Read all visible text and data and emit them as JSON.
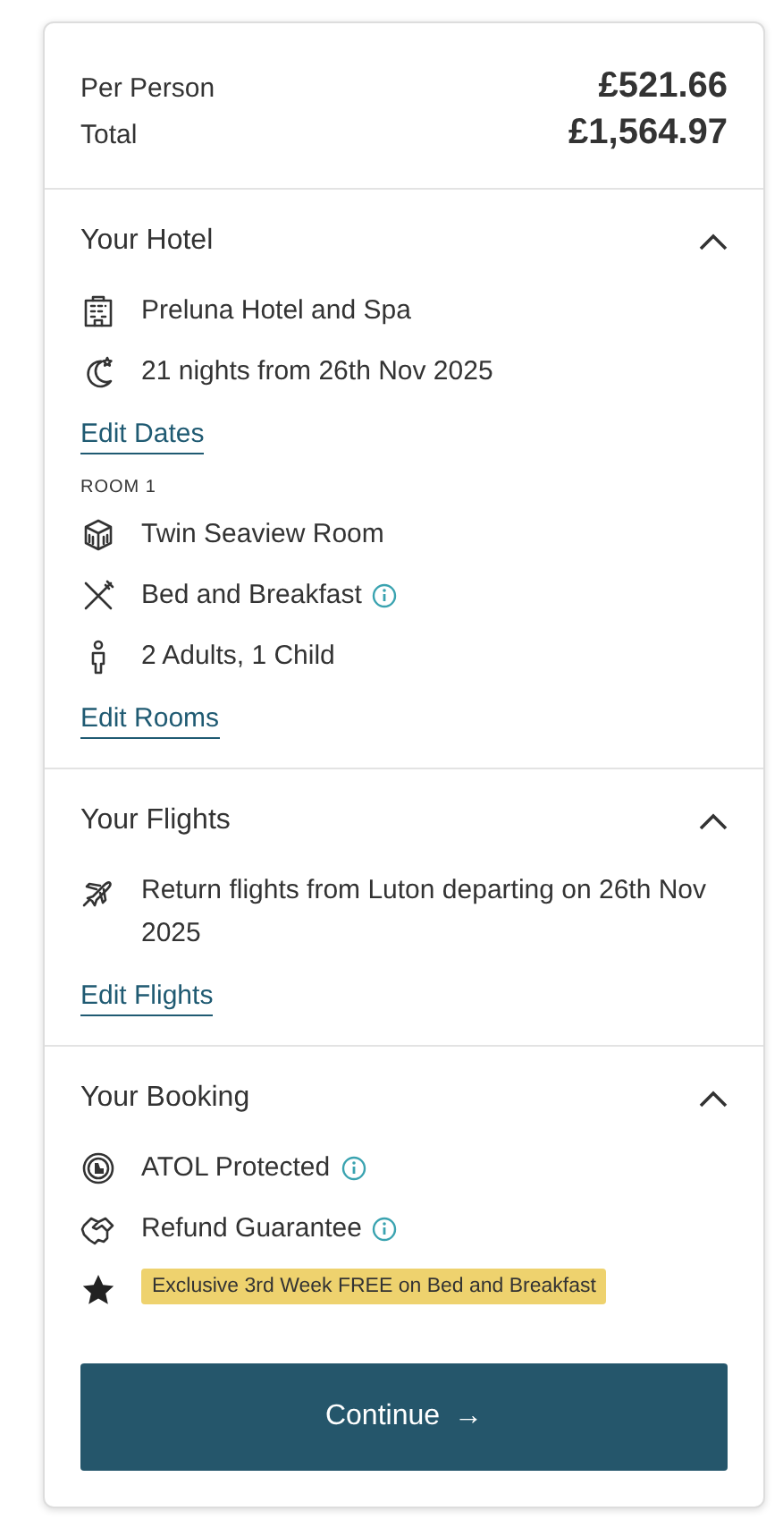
{
  "summary": [
    {
      "label": "Per Person",
      "value": "£521.66"
    },
    {
      "label": "Total",
      "value": "£1,564.97"
    }
  ],
  "sections": [
    {
      "title": "Your Hotel",
      "expanded": true,
      "groups": [
        {
          "items": [
            {
              "kind": "text",
              "text": "Preluna Hotel and Spa"
            },
            {
              "kind": "text",
              "text": "21 nights from 26th Nov 2025"
            }
          ],
          "link": "Edit Dates"
        },
        {
          "heading": "ROOM 1",
          "items": [
            {
              "kind": "text",
              "text": "Twin Seaview Room"
            },
            {
              "kind": "info",
              "text": "Bed and Breakfast"
            },
            {
              "kind": "text",
              "text": "2 Adults, 1 Child"
            }
          ],
          "link": "Edit Rooms"
        }
      ]
    },
    {
      "title": "Your Flights",
      "expanded": true,
      "groups": [
        {
          "items": [
            {
              "kind": "text",
              "text": "Return flights from Luton departing on 26th Nov 2025"
            }
          ],
          "link": "Edit Flights"
        }
      ]
    },
    {
      "title": "Your Booking",
      "expanded": true,
      "groups": [
        {
          "items": [
            {
              "kind": "info",
              "text": "ATOL Protected"
            },
            {
              "kind": "info",
              "text": "Refund Guarantee"
            },
            {
              "kind": "badge",
              "text": "Exclusive 3rd Week FREE on Bed and Breakfast"
            }
          ]
        }
      ]
    }
  ],
  "button": {
    "label": "Continue",
    "arrow": "→"
  }
}
